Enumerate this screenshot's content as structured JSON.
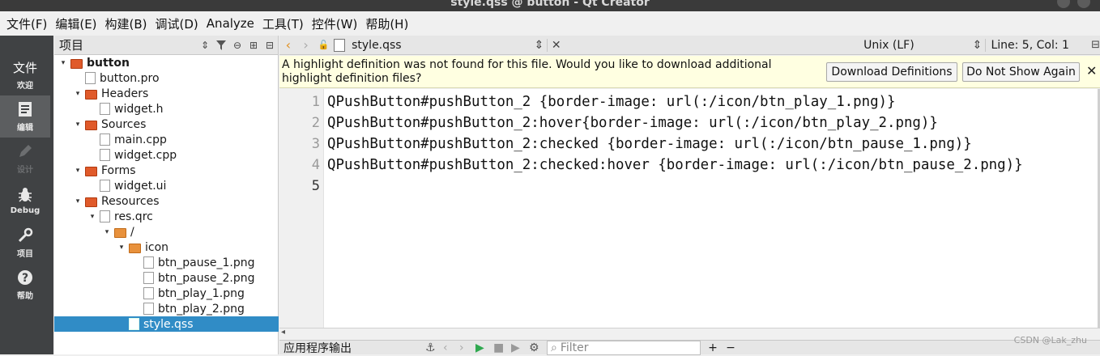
{
  "window": {
    "title": "style.qss @ button - Qt Creator"
  },
  "menu": [
    "文件(F)",
    "编辑(E)",
    "构建(B)",
    "调试(D)",
    "Analyze",
    "工具(T)",
    "控件(W)",
    "帮助(H)"
  ],
  "modes": [
    {
      "label": "欢迎",
      "icon": "welcome-icon",
      "glyph": "文件"
    },
    {
      "label": "编辑",
      "icon": "edit-icon"
    },
    {
      "label": "设计",
      "icon": "design-icon"
    },
    {
      "label": "Debug",
      "icon": "debug-icon"
    },
    {
      "label": "项目",
      "icon": "projects-icon"
    },
    {
      "label": "帮助",
      "icon": "help-icon"
    }
  ],
  "project_panel": {
    "title": "项目",
    "tree": [
      {
        "label": "button",
        "depth": 0,
        "type": "project",
        "expanded": true,
        "bold": true
      },
      {
        "label": "button.pro",
        "depth": 1,
        "type": "pro"
      },
      {
        "label": "Headers",
        "depth": 1,
        "type": "folder-h",
        "expanded": true
      },
      {
        "label": "widget.h",
        "depth": 2,
        "type": "header"
      },
      {
        "label": "Sources",
        "depth": 1,
        "type": "folder-cpp",
        "expanded": true
      },
      {
        "label": "main.cpp",
        "depth": 2,
        "type": "cpp"
      },
      {
        "label": "widget.cpp",
        "depth": 2,
        "type": "cpp"
      },
      {
        "label": "Forms",
        "depth": 1,
        "type": "folder-ui",
        "expanded": true
      },
      {
        "label": "widget.ui",
        "depth": 2,
        "type": "ui"
      },
      {
        "label": "Resources",
        "depth": 1,
        "type": "folder-res",
        "expanded": true
      },
      {
        "label": "res.qrc",
        "depth": 2,
        "type": "qrc",
        "expanded": true
      },
      {
        "label": "/",
        "depth": 3,
        "type": "folder",
        "expanded": true
      },
      {
        "label": "icon",
        "depth": 4,
        "type": "folder",
        "expanded": true
      },
      {
        "label": "btn_pause_1.png",
        "depth": 5,
        "type": "file"
      },
      {
        "label": "btn_pause_2.png",
        "depth": 5,
        "type": "file"
      },
      {
        "label": "btn_play_1.png",
        "depth": 5,
        "type": "file"
      },
      {
        "label": "btn_play_2.png",
        "depth": 5,
        "type": "file"
      },
      {
        "label": "style.qss",
        "depth": 4,
        "type": "file",
        "selected": true
      }
    ]
  },
  "editor_toolbar": {
    "file": "style.qss",
    "line_ending": "Unix (LF)",
    "position": "Line: 5, Col: 1"
  },
  "infobar": {
    "message": "A highlight definition was not found for this file. Would you like to download additional highlight definition files?",
    "download_label": "Download Definitions",
    "dismiss_label": "Do Not Show Again"
  },
  "code": {
    "lines": [
      "QPushButton#pushButton_2 {border-image: url(:/icon/btn_play_1.png)}",
      "QPushButton#pushButton_2:hover{border-image: url(:/icon/btn_play_2.png)}",
      "QPushButton#pushButton_2:checked {border-image: url(:/icon/btn_pause_1.png)}",
      "QPushButton#pushButton_2:checked:hover {border-image: url(:/icon/btn_pause_2.png)}",
      ""
    ],
    "line_numbers": [
      "1",
      "2",
      "3",
      "4",
      "5"
    ],
    "current_line": 5
  },
  "output_bar": {
    "title": "应用程序输出",
    "filter_placeholder": "Filter"
  },
  "watermark": "CSDN @Lak_zhu",
  "colors": {
    "selection": "#308cc6",
    "infobar_bg": "#ffffe1",
    "modebar_bg": "#404244"
  }
}
